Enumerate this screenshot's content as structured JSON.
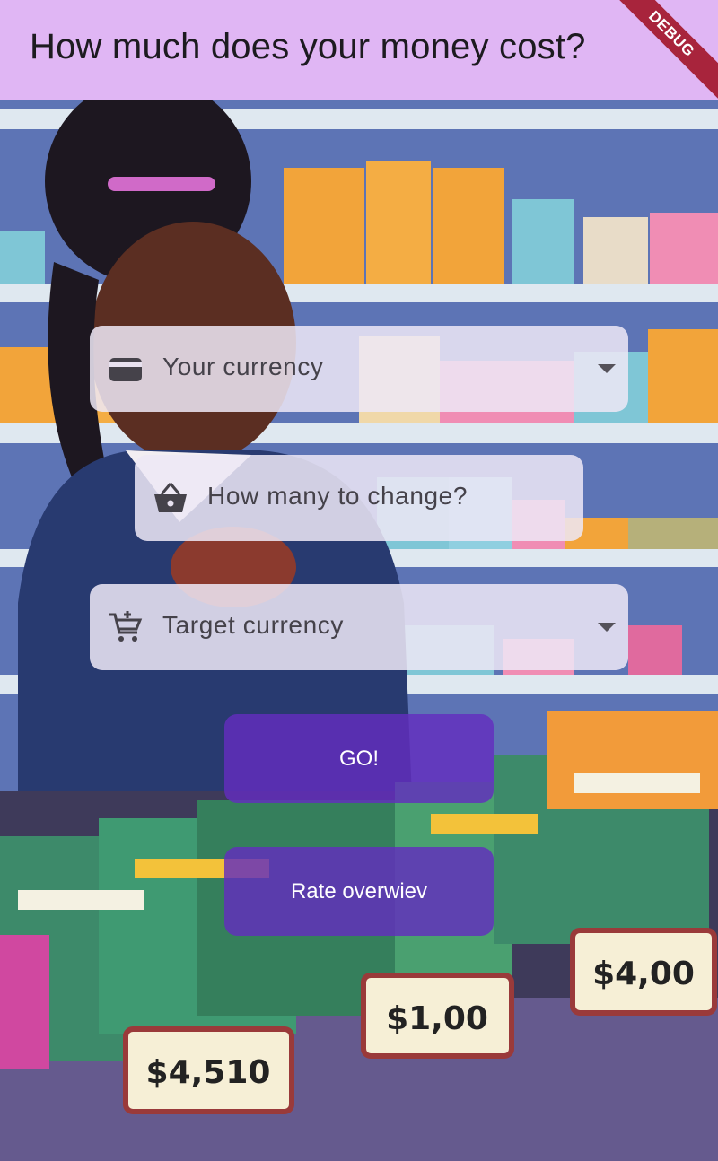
{
  "appbar": {
    "title": "How much does your money cost?",
    "debug_label": "DEBUG"
  },
  "form": {
    "your_currency": {
      "label": "Your currency",
      "icon": "wallet-icon"
    },
    "amount": {
      "label": "How many to change?",
      "icon": "basket-icon"
    },
    "target_currency": {
      "label": "Target currency",
      "icon": "add-cart-icon"
    }
  },
  "buttons": {
    "go": "GO!",
    "rate_overview": "Rate overwiev"
  },
  "price_tags": [
    "$4,510",
    "$1,00",
    "$4,00"
  ],
  "colors": {
    "appbar": "#e0b6f4",
    "button": "#632dbe",
    "debug_banner": "#a8243c"
  }
}
